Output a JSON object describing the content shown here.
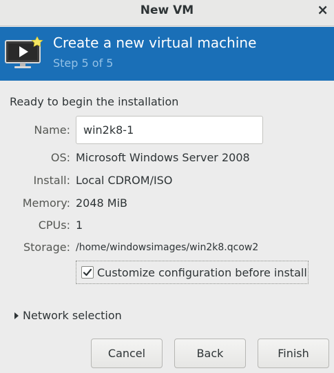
{
  "window": {
    "title": "New VM",
    "close_glyph": "×"
  },
  "banner": {
    "headline": "Create a new virtual machine",
    "step": "Step 5 of 5",
    "icon": "monitor-icon",
    "background_color": "#1a6fb7"
  },
  "summary": {
    "heading": "Ready to begin the installation",
    "name_label": "Name:",
    "name_value": "win2k8-1",
    "os_label": "OS:",
    "os_value": "Microsoft Windows Server 2008",
    "install_label": "Install:",
    "install_value": "Local CDROM/ISO",
    "memory_label": "Memory:",
    "memory_value": "2048 MiB",
    "cpus_label": "CPUs:",
    "cpus_value": "1",
    "storage_label": "Storage:",
    "storage_value": "/home/windowsimages/win2k8.qcow2"
  },
  "options": {
    "customize_label": "Customize configuration before install",
    "customize_checked": true,
    "network_label": "Network selection",
    "network_expanded": false
  },
  "buttons": {
    "cancel": "Cancel",
    "back": "Back",
    "finish": "Finish"
  }
}
